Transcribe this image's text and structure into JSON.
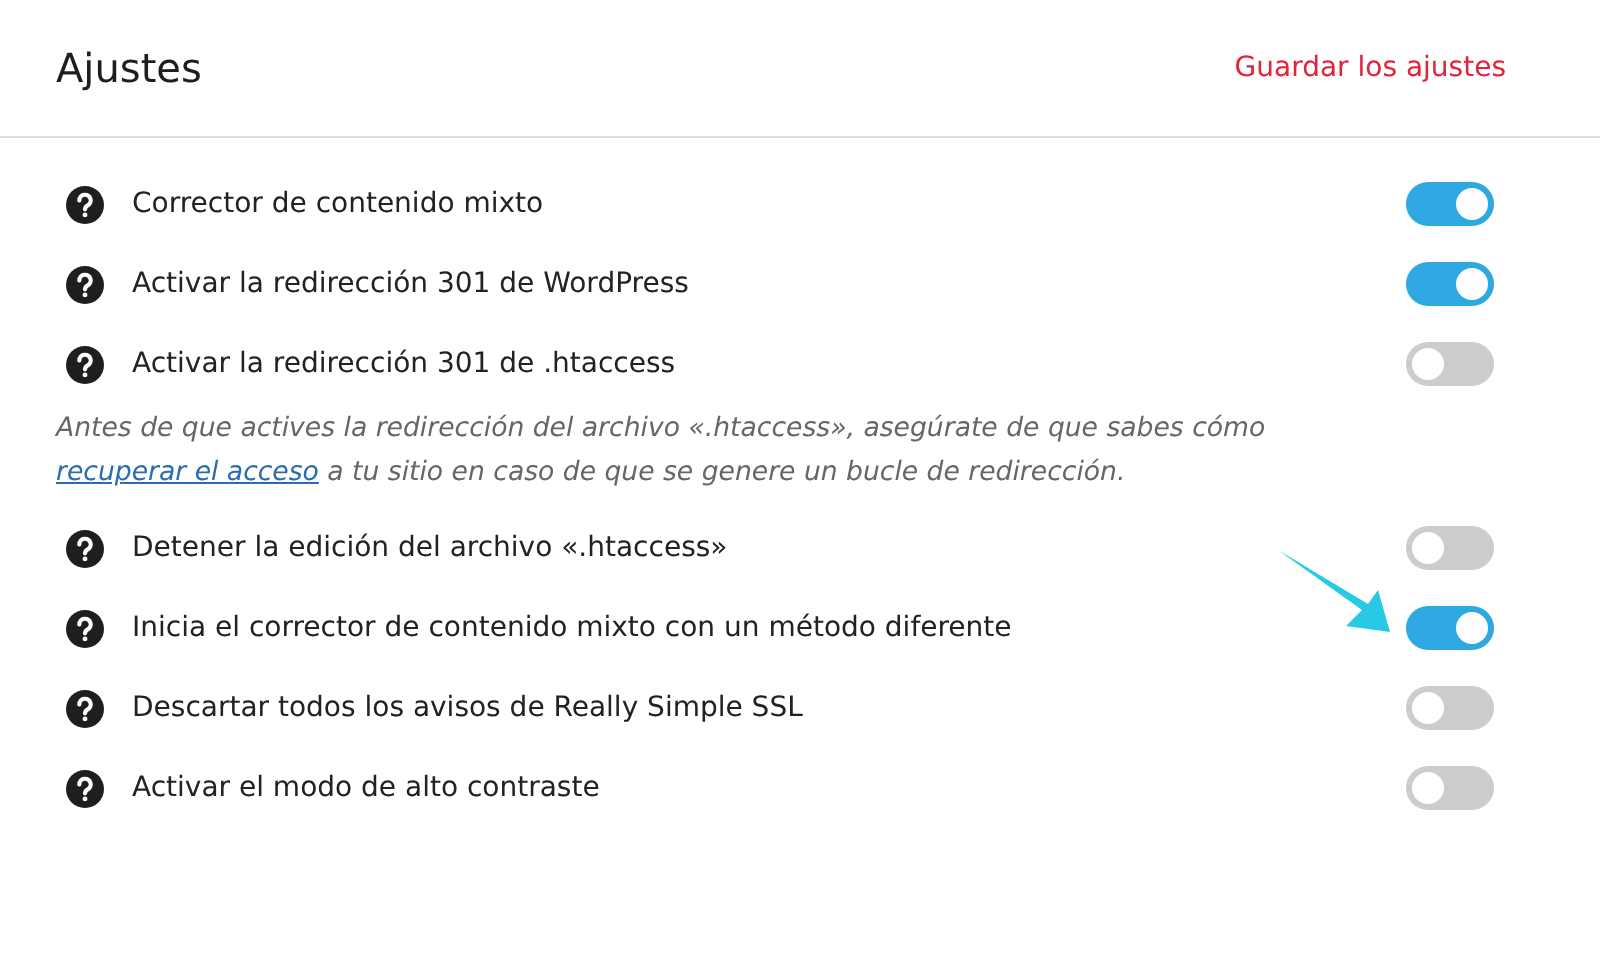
{
  "header": {
    "title": "Ajustes",
    "save_link": "Guardar los ajustes"
  },
  "items": [
    {
      "kind": "toggle",
      "label": "Corrector de contenido mixto",
      "on": true
    },
    {
      "kind": "toggle",
      "label": "Activar la redirección 301 de WordPress",
      "on": true
    },
    {
      "kind": "toggle",
      "label": "Activar la redirección 301 de .htaccess",
      "on": false
    },
    {
      "kind": "note",
      "before": "Antes de que actives la redirección del archivo «.htaccess», asegúrate de que sabes cómo",
      "link": "recuperar el acceso",
      "after": "a tu sitio en caso de que se genere un bucle de redirección."
    },
    {
      "kind": "toggle",
      "label": "Detener la edición del archivo «.htaccess»",
      "on": false
    },
    {
      "kind": "toggle",
      "label": "Inicia el corrector de contenido mixto con un método diferente",
      "on": true
    },
    {
      "kind": "toggle",
      "label": "Descartar todos los avisos de Really Simple SSL",
      "on": false
    },
    {
      "kind": "toggle",
      "label": "Activar el modo de alto contraste",
      "on": false
    }
  ]
}
